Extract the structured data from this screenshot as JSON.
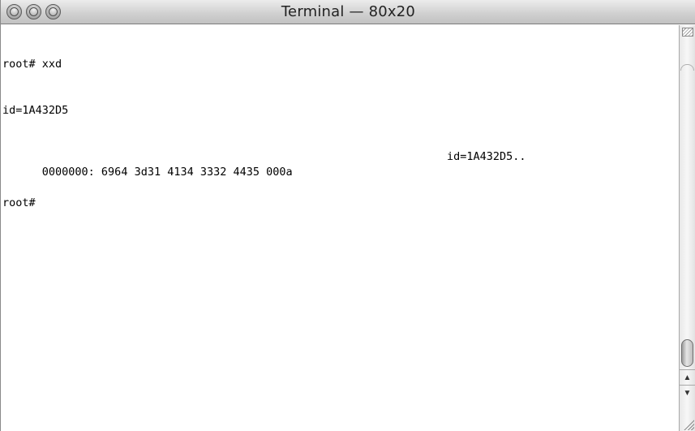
{
  "window": {
    "title": "Terminal — 80x20"
  },
  "terminal": {
    "lines": [
      "root# xxd",
      "id=1A432D5",
      "0000000: 6964 3d31 4134 3332 4435 000a",
      "root#"
    ],
    "hexdump_ascii": "id=1A432D5.."
  },
  "icons": {
    "close": "close-button-icon",
    "minimize": "minimize-button-icon",
    "zoom": "zoom-button-icon",
    "split": "split-pane-icon",
    "scroll_up": "scroll-up-arrow-icon",
    "scroll_down": "scroll-down-arrow-icon",
    "resize": "resize-grip-icon"
  },
  "colors": {
    "background": "#ffffff",
    "text": "#000000",
    "titlebar": "#cfcfcf"
  },
  "scroll": {
    "position": 1.0
  }
}
